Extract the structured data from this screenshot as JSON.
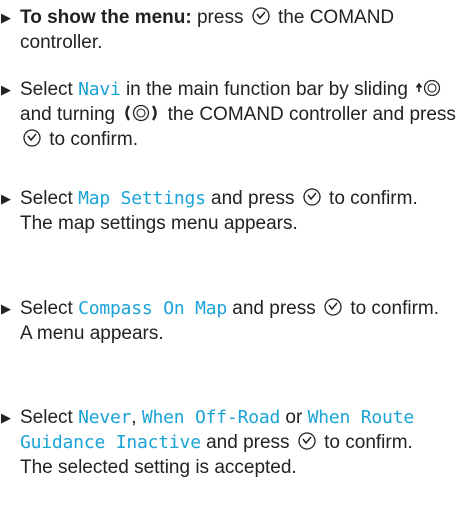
{
  "steps": [
    {
      "lead": "To show the menu:",
      "t1": "press",
      "t2": "the COMAND controller."
    },
    {
      "t1": "Select",
      "ui1": "Navi",
      "t2": "in the main function bar by sliding",
      "t3": "and turning",
      "t4": "the COMAND controller and press",
      "t5": "to confirm."
    },
    {
      "t1": "Select",
      "ui1": "Map Settings",
      "t2": "and press",
      "t3": "to confirm.",
      "result": "The map settings menu appears."
    },
    {
      "t1": "Select",
      "ui1": "Compass On Map",
      "t2": "and press",
      "t3": "to confirm.",
      "result": "A menu appears."
    },
    {
      "t1": "Select",
      "ui1": "Never",
      "comma": ",",
      "ui2": "When Off-Road",
      "or": "or",
      "ui3": "When Route Guidance Inactive",
      "t2": "and press",
      "t3": "to confirm.",
      "result": "The selected setting is accepted."
    }
  ],
  "icons": {
    "bullet": "triangle-right",
    "press": "controller-press-icon",
    "slide": "controller-slide-up-icon",
    "turn": "controller-turn-icon"
  },
  "colors": {
    "ui_label": "#1aa3d6",
    "text": "#222222"
  }
}
